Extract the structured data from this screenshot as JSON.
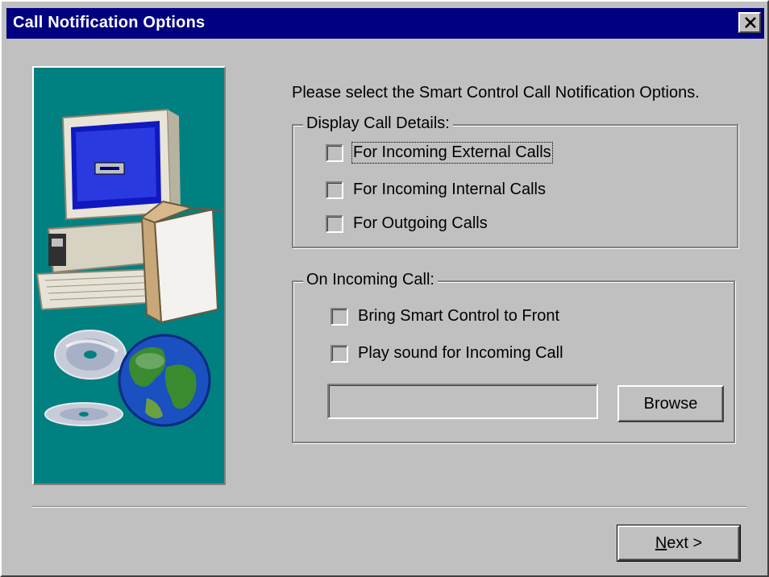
{
  "window": {
    "title": "Call Notification Options",
    "close_icon": "close-icon"
  },
  "instruction": "Please select the Smart Control Call Notification Options.",
  "display_group": {
    "title": "Display Call Details:",
    "options": [
      {
        "label": "For Incoming External Calls",
        "checked": false,
        "focused": true
      },
      {
        "label": "For Incoming Internal Calls",
        "checked": false
      },
      {
        "label": "For Outgoing Calls",
        "checked": false
      }
    ]
  },
  "incoming_group": {
    "title": "On Incoming Call:",
    "options": [
      {
        "label": "Bring Smart Control to Front",
        "checked": false
      },
      {
        "label": "Play sound for Incoming Call",
        "checked": false
      }
    ],
    "sound_file_value": "",
    "browse_label": "Browse"
  },
  "footer": {
    "next_label": "Next >"
  },
  "illustration": {
    "icons": [
      "computer-icon",
      "box-icon",
      "cd-icon",
      "globe-icon"
    ]
  },
  "colors": {
    "title_bar": "#000080",
    "dialog_bg": "#c0c0c0",
    "art_bg": "#008080"
  }
}
